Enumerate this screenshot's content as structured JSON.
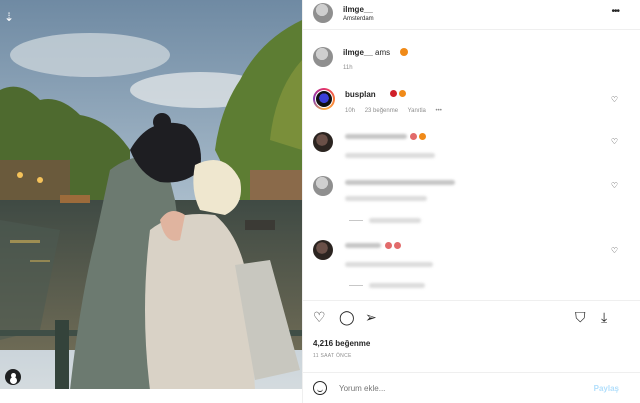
{
  "header": {
    "username": "ilmge__",
    "location": "Amsterdam",
    "more_icon": "more-icon"
  },
  "caption": {
    "username": "ilmge__",
    "text": "ams",
    "time": "11h"
  },
  "comments": [
    {
      "username": "busplan",
      "time": "10h",
      "likes": "23 beğenme",
      "reply": "Yanıtla",
      "emoji_colors": [
        "#d0202a",
        "#f08a18"
      ]
    }
  ],
  "actions": {
    "likes": "4,216 beğenme",
    "posted": "11 SAAT ÖNCE"
  },
  "comment_bar": {
    "placeholder": "Yorum ekle...",
    "post_label": "Paylaş"
  },
  "colors": {
    "accent_post": "#b2dffc",
    "text": "#262626",
    "muted": "#8e8e8e"
  }
}
